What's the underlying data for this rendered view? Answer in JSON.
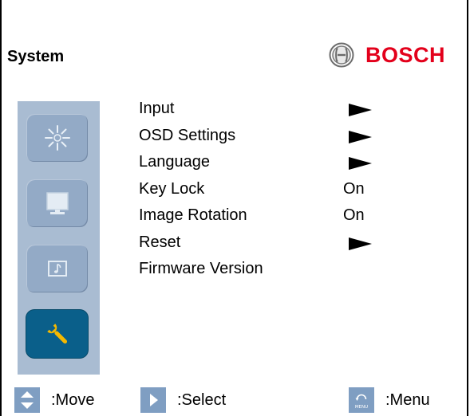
{
  "header": {
    "title": "System",
    "brand_name": "BOSCH",
    "brand_color": "#e3001b"
  },
  "sidebar": {
    "items": [
      {
        "icon": "brightness-sun-icon",
        "active": false
      },
      {
        "icon": "monitor-icon",
        "active": false
      },
      {
        "icon": "audio-music-note-icon",
        "active": false
      },
      {
        "icon": "wrench-icon",
        "active": true
      }
    ],
    "background_color": "#a9bcd2",
    "active_color": "#0a5f8a"
  },
  "menu": {
    "items": [
      {
        "label": "Input",
        "value": "",
        "has_submenu": true
      },
      {
        "label": "OSD Settings",
        "value": "",
        "has_submenu": true
      },
      {
        "label": "Language",
        "value": "",
        "has_submenu": true
      },
      {
        "label": "Key Lock",
        "value": "On",
        "has_submenu": false
      },
      {
        "label": "Image Rotation",
        "value": "On",
        "has_submenu": false
      },
      {
        "label": "Reset",
        "value": "",
        "has_submenu": true
      },
      {
        "label": "Firmware Version",
        "value": "",
        "has_submenu": false
      }
    ]
  },
  "footer": {
    "move": {
      "icon": "up-down-arrows-icon",
      "label": ":Move"
    },
    "select": {
      "icon": "play-right-arrow-icon",
      "label": ":Select"
    },
    "menu": {
      "icon": "menu-return-icon",
      "label": ":Menu",
      "icon_text": "MENU"
    }
  }
}
